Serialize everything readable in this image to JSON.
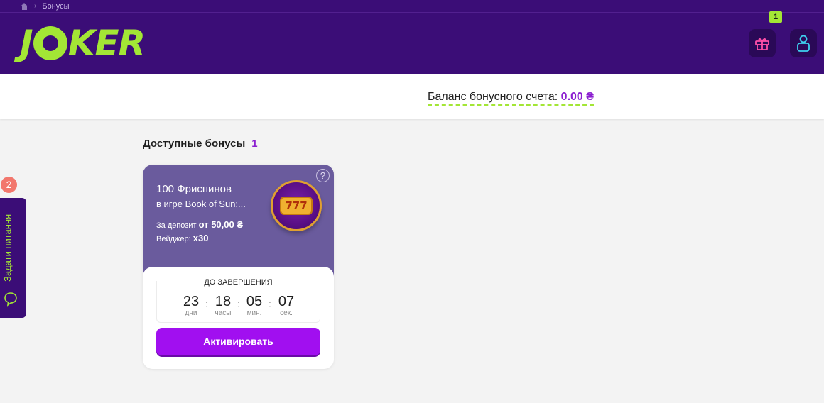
{
  "breadcrumb": {
    "current": "Бонусы"
  },
  "header": {
    "logo_text": "JOKER",
    "gift_badge": "1"
  },
  "balance": {
    "label": "Баланс бонусного счета:",
    "value": "0.00 ₴"
  },
  "section": {
    "title": "Доступные бонусы",
    "count": "1"
  },
  "bonus_card": {
    "help": "?",
    "title": "100 Фриспинов",
    "game_prefix": "в игре",
    "game_name": "Book of Sun:...",
    "deposit_label": "За депозит",
    "deposit_value": "от 50,00 ₴",
    "wager_label": "Вейджер:",
    "wager_value": "x30",
    "slot_symbols": "777",
    "ends_label": "ДО ЗАВЕРШЕНИЯ",
    "timer": [
      {
        "value": "23",
        "unit": "дни"
      },
      {
        "value": "18",
        "unit": "часы"
      },
      {
        "value": "05",
        "unit": "мин."
      },
      {
        "value": "07",
        "unit": "сек."
      }
    ],
    "activate_label": "Активировать"
  },
  "feedback": {
    "label": "Задати питання",
    "badge": "2"
  },
  "colors": {
    "brand_purple": "#3b0d77",
    "accent_green": "#a3e635",
    "accent_violet": "#a10ff0",
    "card_purple": "#6a5b9d"
  },
  "icons": [
    "home-icon",
    "gift-icon",
    "user-icon",
    "question-icon",
    "slot-777-icon",
    "chat-bubble-icon"
  ]
}
